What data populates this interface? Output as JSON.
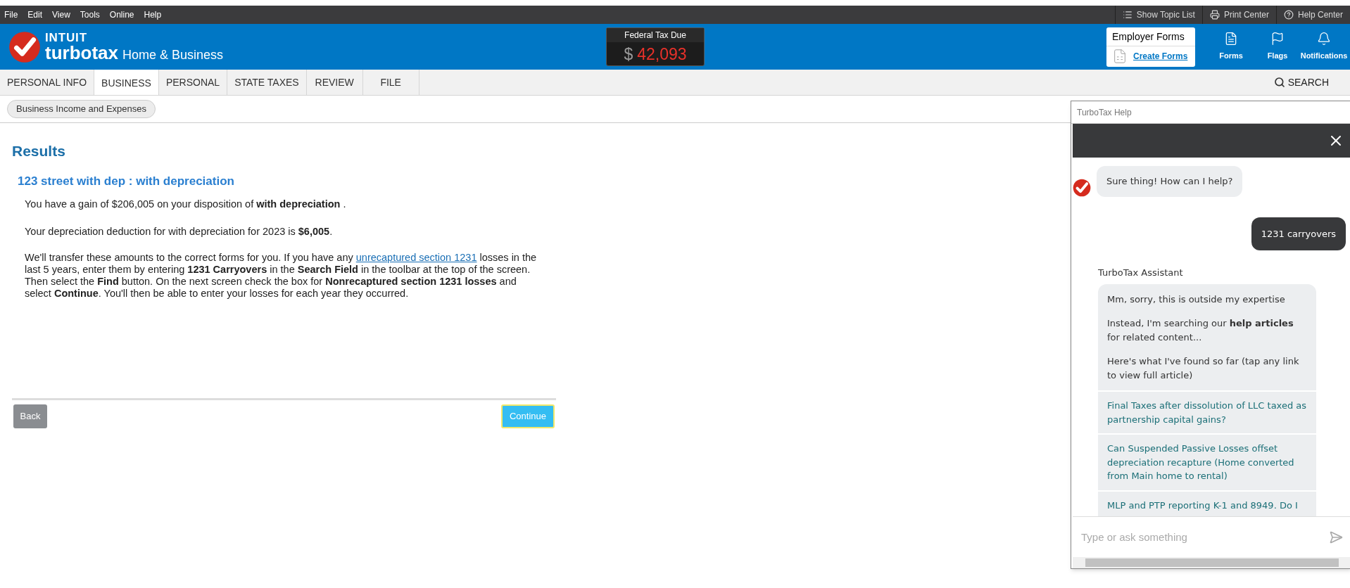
{
  "menu": [
    "File",
    "Edit",
    "View",
    "Tools",
    "Online",
    "Help"
  ],
  "toolbar_links": [
    {
      "label": "Show Topic List",
      "kind": "list"
    },
    {
      "label": "Print Center",
      "kind": "print"
    },
    {
      "label": "Help Center",
      "kind": "help"
    }
  ],
  "brand": {
    "company": "INTUIT",
    "product": "turbotax",
    "edition": "Home & Business"
  },
  "tax_due": {
    "label": "Federal Tax Due",
    "currency": "$",
    "amount": "42,093"
  },
  "employer_forms": {
    "title": "Employer Forms",
    "link": "Create Forms"
  },
  "header_buttons": [
    {
      "label": "Forms",
      "kind": "forms"
    },
    {
      "label": "Flags",
      "kind": "flags"
    },
    {
      "label": "Notifications",
      "kind": "notifications"
    }
  ],
  "tabs": [
    {
      "label": "PERSONAL INFO",
      "selected": false
    },
    {
      "label": "BUSINESS",
      "selected": true
    },
    {
      "label": "PERSONAL",
      "selected": false
    },
    {
      "label": "STATE TAXES",
      "selected": false
    },
    {
      "label": "REVIEW",
      "selected": false
    },
    {
      "label": "FILE",
      "selected": false
    }
  ],
  "search": "SEARCH",
  "breadcrumb": "Business Income and Expenses",
  "page": {
    "title": "Results",
    "subtitle": "123 street with dep : with depreciation",
    "paragraphs": [
      "You have a gain of $206,005 on your disposition of **with depreciation** .",
      "Your depreciation deduction for with depreciation  for 2023 is **$6,005**."
    ],
    "note": {
      "before": "We'll transfer these amounts to the correct forms for you. If you have any",
      "link": "unrecaptured section 1231",
      "after": "losses in the last 5 years, enter them by entering **1231 Carryovers** in the **Search Field** in the toolbar at the top of the screen. Then select the **Find** button. On the next screen check the box for **Nonrecaptured section 1231 losses** and select **Continue**. You'll then be able to enter your losses for each year they occurred."
    }
  },
  "buttons": {
    "back": "Back",
    "continue": "Continue"
  },
  "help": {
    "title": "TurboTax Help",
    "messages": [
      {
        "kind": "bot",
        "text": "Sure thing! How can I help?"
      },
      {
        "kind": "user",
        "text": "1231 carryovers"
      }
    ],
    "assistant_name": "TurboTax Assistant",
    "reply": [
      "Mm, sorry, this is outside my expertise",
      "Instead, I'm searching our **help articles** for related content...",
      "Here's what I've found so far (tap any link to view full article)"
    ],
    "articles": [
      "Final Taxes after dissolution of LLC taxed as partnership capital gains?",
      "Can Suspended Passive Losses offset depreciation recapture (Home converted from Main home to rental)",
      "MLP and PTP reporting K-1 and 8949. Do I"
    ],
    "placeholder": "Type or ask something"
  }
}
